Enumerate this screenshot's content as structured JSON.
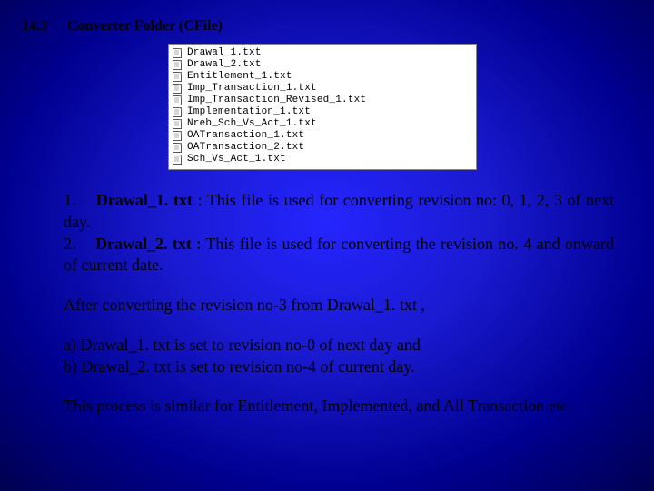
{
  "section": {
    "number": "14.3",
    "title": "Converter Folder  (CFile)"
  },
  "folder_files": [
    "Drawal_1.txt",
    "Drawal_2.txt",
    "Entitlement_1.txt",
    "Imp_Transaction_1.txt",
    "Imp_Transaction_Revised_1.txt",
    "Implementation_1.txt",
    "Nreb_Sch_Vs_Act_1.txt",
    "OATransaction_1.txt",
    "OATransaction_2.txt",
    "Sch_Vs_Act_1.txt"
  ],
  "desc": {
    "item1_num": "1.",
    "item1_label": "Drawal_1. txt",
    "item1_text": " : This file is used for converting revision no: 0, 1, 2, 3 of next day.",
    "item2_num": "2.",
    "item2_label": "Drawal_2. txt",
    "item2_text": " :  This file is used for converting the revision no. 4 and onward of current date.",
    "after_heading": "After converting the revision no-3 from Drawal_1. txt ,",
    "bullet_a": "a)    Drawal_1. txt  is set to revision no-0 of next day and",
    "bullet_b": "b)    Drawal_2. txt is set to revision no-4 of current day.",
    "closing": "This process is similar for Entitlement, Implemented, and All Transaction etc."
  }
}
